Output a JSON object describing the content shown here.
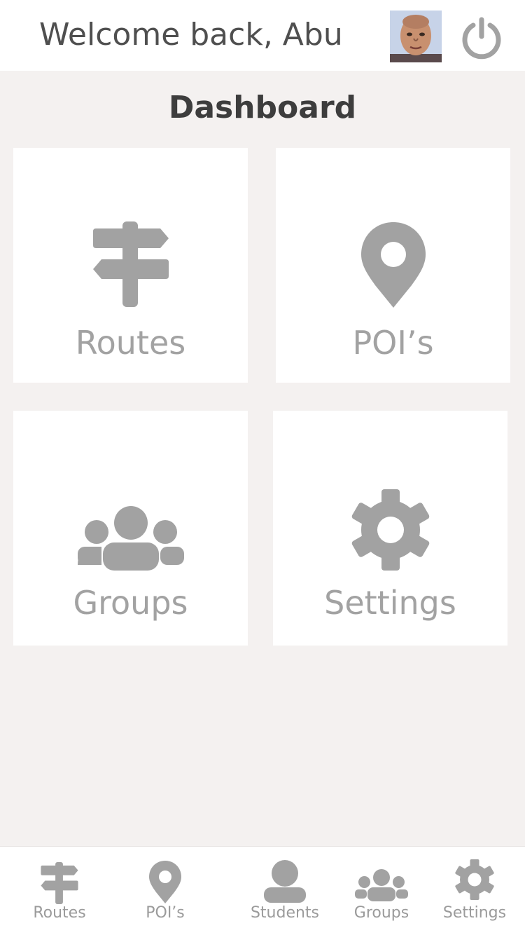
{
  "header": {
    "welcome_text": "Welcome back, Abu",
    "avatar_alt": "user-avatar",
    "power_icon": "power-icon"
  },
  "page": {
    "title": "Dashboard"
  },
  "tiles": [
    {
      "label": "Routes",
      "icon": "signpost-icon"
    },
    {
      "label": "POI’s",
      "icon": "map-pin-icon"
    },
    {
      "label": "Groups",
      "icon": "group-icon"
    },
    {
      "label": "Settings",
      "icon": "gear-icon"
    }
  ],
  "bottom_nav": [
    {
      "label": "Routes",
      "icon": "signpost-icon"
    },
    {
      "label": "POI’s",
      "icon": "map-pin-icon"
    },
    {
      "label": "Students",
      "icon": "user-icon"
    },
    {
      "label": "Groups",
      "icon": "group-icon"
    },
    {
      "label": "Settings",
      "icon": "gear-icon"
    }
  ],
  "colors": {
    "background": "#f4f1f0",
    "card": "#ffffff",
    "icon": "#a2a2a2",
    "text_dark": "#4f4f4f"
  }
}
